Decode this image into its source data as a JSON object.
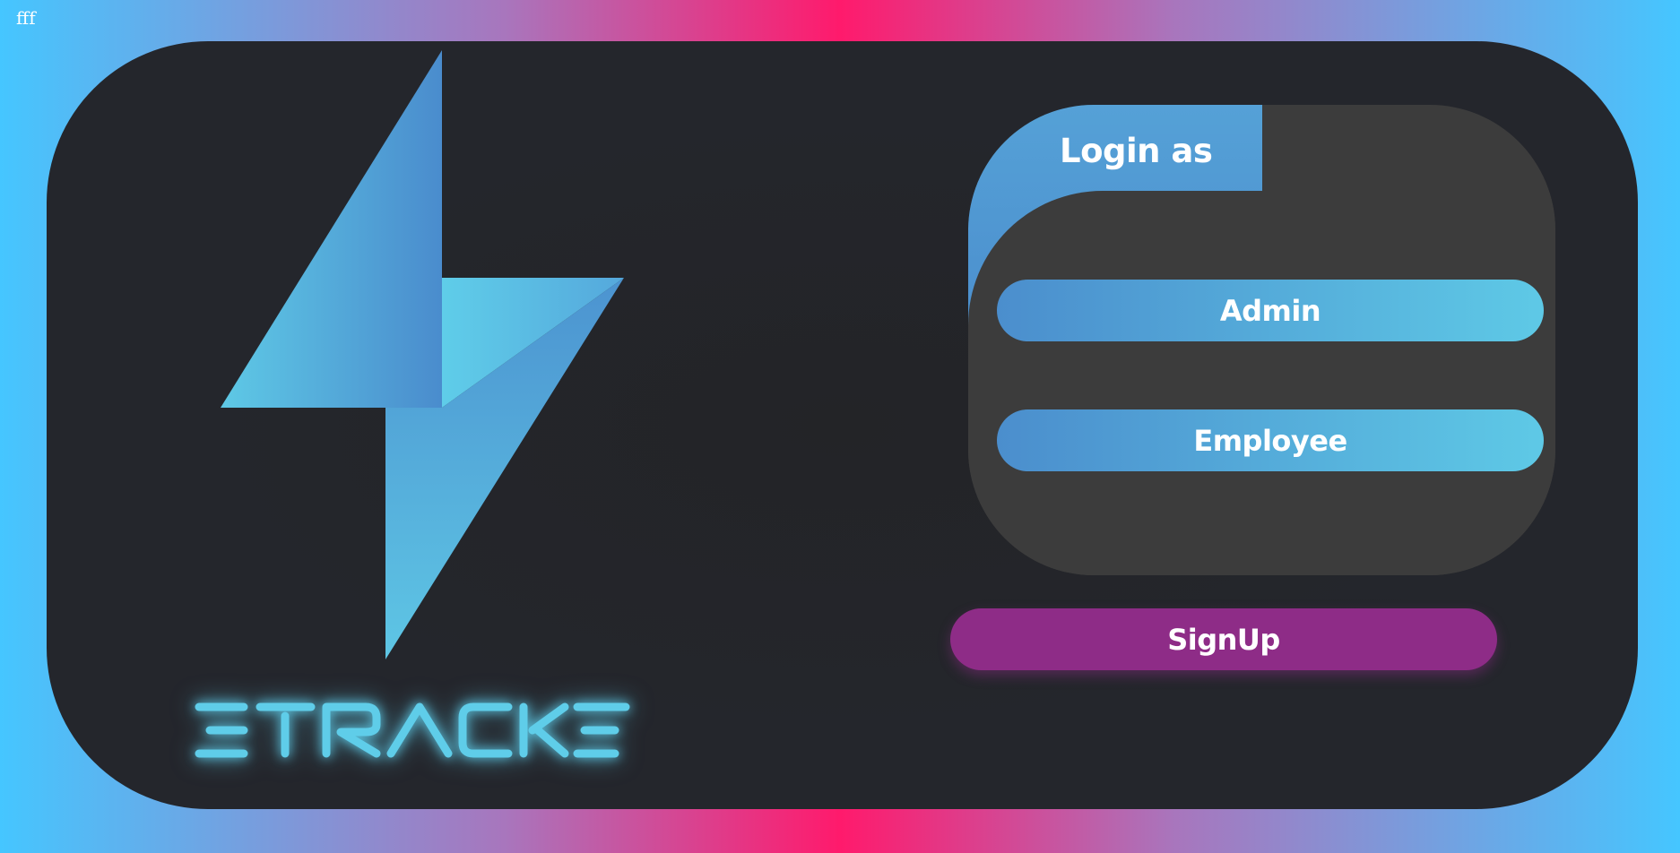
{
  "page": {
    "corner_text": "fff"
  },
  "brand": {
    "name": "ETRACKER",
    "logo_icon": "lightning-bolt-icon",
    "colors": {
      "accent_blue_start": "#4b8ecd",
      "accent_blue_end": "#5ec9e6",
      "signup_purple": "#8e2c87",
      "panel_dark": "#24262c",
      "card_gray": "#3c3c3c"
    }
  },
  "login": {
    "title": "Login as",
    "options": [
      {
        "label": "Admin"
      },
      {
        "label": "Employee"
      }
    ]
  },
  "signup": {
    "label": "SignUp"
  }
}
